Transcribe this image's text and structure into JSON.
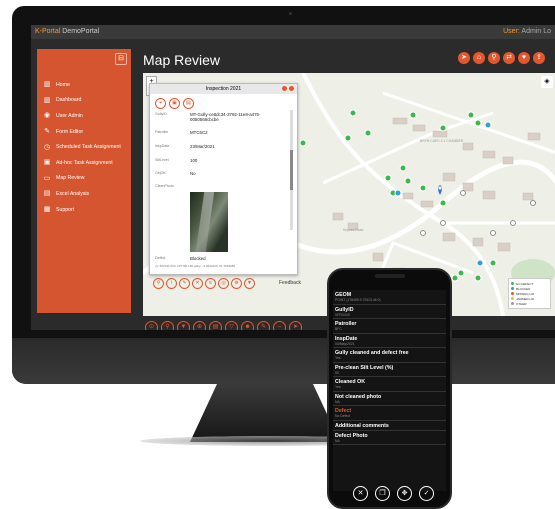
{
  "app": {
    "brand_k": "K-Portal",
    "brand_rest": "DemoPortal",
    "user_label": "User:",
    "user_name": "Admin",
    "logout": "Lo"
  },
  "sidebar": {
    "items": [
      {
        "label": "Home",
        "icon": "chart-icon"
      },
      {
        "label": "Dashboard",
        "icon": "chart-icon"
      },
      {
        "label": "User Admin",
        "icon": "user-icon"
      },
      {
        "label": "Form Editor",
        "icon": "edit-icon"
      },
      {
        "label": "Scheduled Task Assignment",
        "icon": "clock-icon"
      },
      {
        "label": "Ad-hoc Task Assignment",
        "icon": "task-icon"
      },
      {
        "label": "Map Review",
        "icon": "map-icon"
      },
      {
        "label": "Excel Analysis",
        "icon": "table-icon"
      },
      {
        "label": "Support",
        "icon": "grid-icon"
      }
    ]
  },
  "page": {
    "title": "Map Review"
  },
  "popup": {
    "title": "Inspection 2021",
    "rows": [
      {
        "key": "GullyID",
        "value": "MT-Gully-ce8dc34-3792-11e8-a475-0050568cbcbe"
      },
      {
        "key": "Patroller",
        "value": "MTC6C2"
      },
      {
        "key": "InspDate",
        "value": "23/Mar/2021"
      },
      {
        "key": "SiltLevel",
        "value": "100"
      },
      {
        "key": "ObjOK",
        "value": "No"
      },
      {
        "key": "CleanPhoto",
        "value": ""
      },
      {
        "key": "Defect",
        "value": "Blocked"
      }
    ],
    "coords": "xy: 502191.060, 207790.180 wkkp: -3.4542229, 51.7663684",
    "feedback": "Feedback"
  },
  "map": {
    "labels": [
      "BRYN CAED 4 1 CHAMBER",
      "Keynes Road"
    ],
    "legend": [
      {
        "label": "NO DEFECT",
        "color": "#3bb84a"
      },
      {
        "label": "BLOCKED",
        "color": "#2c9fd8"
      },
      {
        "label": "MISSING LID",
        "color": "#e4572e"
      },
      {
        "label": "JAMMED LID",
        "color": "#f2c12e"
      },
      {
        "label": "OTHER",
        "color": "#999999"
      }
    ]
  },
  "phone": {
    "fields": [
      {
        "label": "GEOM",
        "value": "POINT (178495.9 72523.46 0)"
      },
      {
        "label": "GullyID",
        "value": "VFRX349"
      },
      {
        "label": "Patroller",
        "value": "BFC"
      },
      {
        "label": "InspDate",
        "value": "04/May/2021"
      },
      {
        "label": "Gully cleaned and defect free",
        "value": "Yes"
      },
      {
        "label": "Pre-clean Silt Level (%)",
        "value": "95"
      },
      {
        "label": "Cleaned OK",
        "value": "Yes"
      },
      {
        "label": "Not cleaned photo",
        "value": "NA"
      },
      {
        "label": "Defect",
        "value": "No Defect",
        "red": true
      },
      {
        "label": "Additional comments",
        "value": ""
      },
      {
        "label": "Defect Photo",
        "value": "NA"
      }
    ]
  }
}
